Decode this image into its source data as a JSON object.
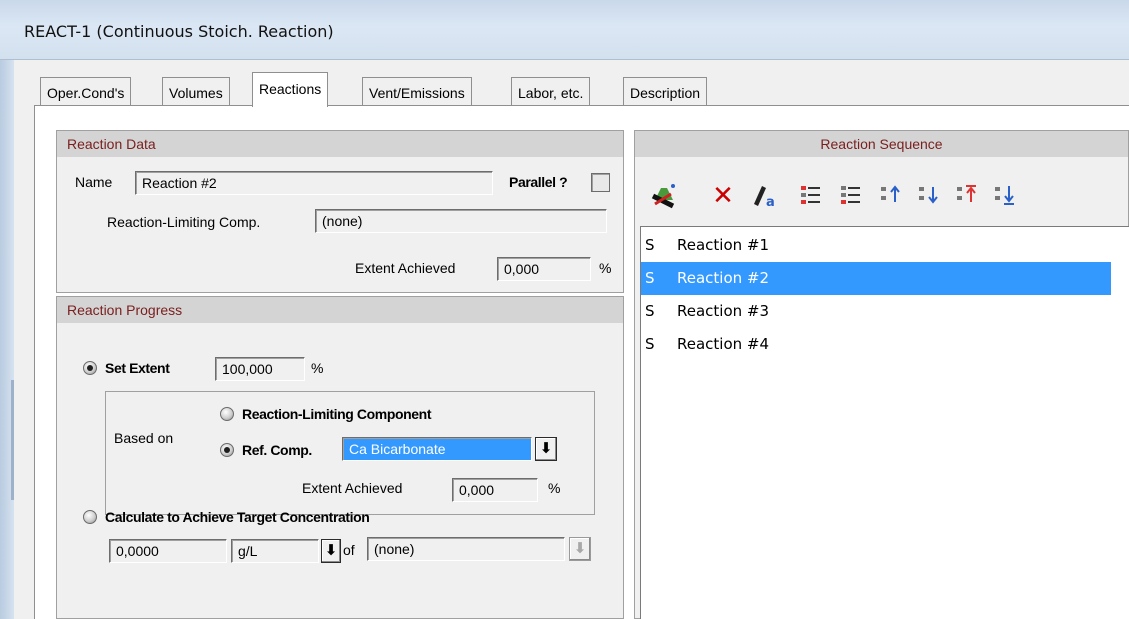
{
  "window": {
    "title": "REACT-1 (Continuous Stoich. Reaction)"
  },
  "tabs": [
    {
      "label": "Oper.Cond's",
      "active": false
    },
    {
      "label": "Volumes",
      "active": false
    },
    {
      "label": "Reactions",
      "active": true
    },
    {
      "label": "Vent/Emissions",
      "active": false
    },
    {
      "label": "Labor, etc.",
      "active": false
    },
    {
      "label": "Description",
      "active": false
    }
  ],
  "reaction_data": {
    "header": "Reaction Data",
    "name_label": "Name",
    "name_value": "Reaction #2",
    "parallel_label": "Parallel ?",
    "parallel_checked": false,
    "limiting_label": "Reaction-Limiting Comp.",
    "limiting_value": "(none)",
    "extent_label": "Extent Achieved",
    "extent_value": "0,000",
    "extent_unit": "%"
  },
  "reaction_progress": {
    "header": "Reaction Progress",
    "set_extent_label": "Set Extent",
    "set_extent_selected": true,
    "set_extent_value": "100,000",
    "set_extent_unit": "%",
    "based_on_label": "Based on",
    "rlc_option_label": "Reaction-Limiting Component",
    "rlc_selected": false,
    "ref_comp_label": "Ref. Comp.",
    "ref_comp_selected": true,
    "ref_comp_value": "Ca Bicarbonate",
    "extent_label": "Extent Achieved",
    "extent_value": "0,000",
    "extent_unit": "%",
    "target_label": "Calculate to Achieve Target Concentration",
    "target_selected": false,
    "target_value": "0,0000",
    "target_unit": "g/L",
    "of_label": "of",
    "target_comp": "(none)"
  },
  "reaction_sequence": {
    "header": "Reaction Sequence",
    "toolbar_icons": [
      "new-reaction-icon",
      "delete-icon",
      "edit-icon",
      "list-icon-1",
      "list-icon-2",
      "move-up-icon",
      "move-down-icon",
      "move-top-icon",
      "move-bottom-icon"
    ],
    "items": [
      {
        "type": "S",
        "name": "Reaction #1",
        "selected": false
      },
      {
        "type": "S",
        "name": "Reaction #2",
        "selected": true
      },
      {
        "type": "S",
        "name": "Reaction #3",
        "selected": false
      },
      {
        "type": "S",
        "name": "Reaction #4",
        "selected": false
      }
    ]
  },
  "colors": {
    "selection": "#3399ff",
    "header_text": "#7a1e1e",
    "delete_icon": "#cc0000"
  }
}
